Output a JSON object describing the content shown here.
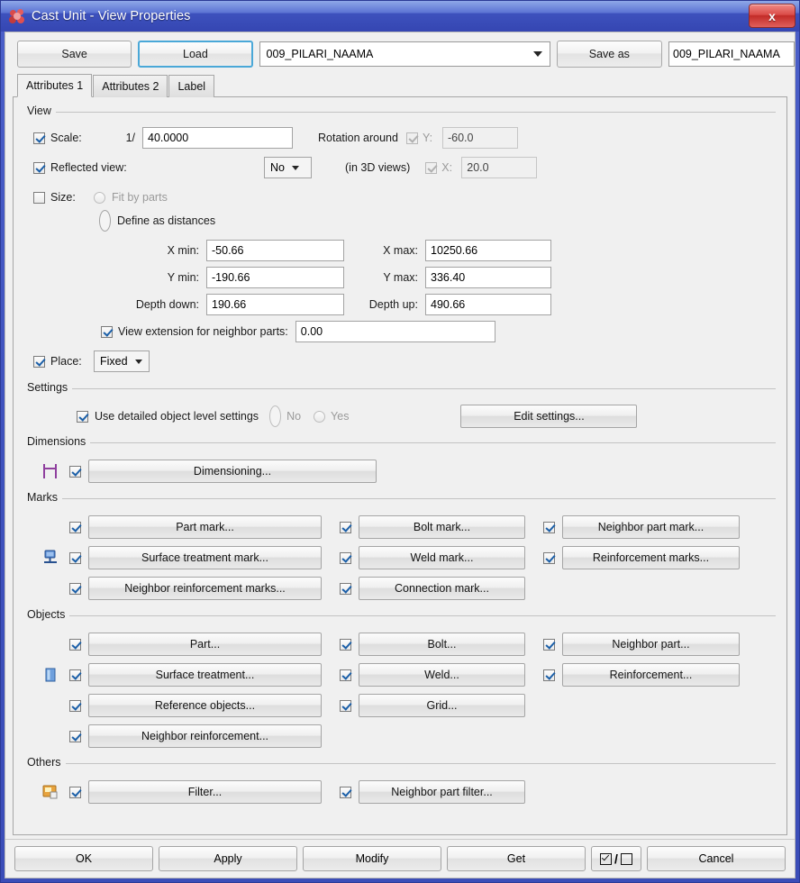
{
  "window": {
    "title": "Cast Unit - View Properties",
    "icon": "cast-unit-icon",
    "close_label": "x"
  },
  "preset_bar": {
    "save_label": "Save",
    "load_label": "Load",
    "preset_value": "009_PILARI_NAAMA",
    "save_as_label": "Save as",
    "save_as_value": "009_PILARI_NAAMA"
  },
  "tabs": [
    {
      "label": "Attributes 1",
      "active": true
    },
    {
      "label": "Attributes 2",
      "active": false
    },
    {
      "label": "Label",
      "active": false
    }
  ],
  "view_group": {
    "title": "View",
    "scale_label": "Scale:",
    "scale_prefix": "1/",
    "scale_value": "40.0000",
    "reflected_label": "Reflected view:",
    "reflected_value": "No",
    "rotation_label": "Rotation around",
    "rotation_sub_label": "(in 3D views)",
    "rot_y_label": "Y:",
    "rot_y_value": "-60.0",
    "rot_x_label": "X:",
    "rot_x_value": "20.0",
    "size_label": "Size:",
    "fit_by_parts_label": "Fit by parts",
    "define_as_distances_label": "Define as distances",
    "x_min_label": "X min:",
    "x_min_value": "-50.66",
    "x_max_label": "X max:",
    "x_max_value": "10250.66",
    "y_min_label": "Y min:",
    "y_min_value": "-190.66",
    "y_max_label": "Y max:",
    "y_max_value": "336.40",
    "depth_down_label": "Depth down:",
    "depth_down_value": "190.66",
    "depth_up_label": "Depth up:",
    "depth_up_value": "490.66",
    "view_extension_label": "View extension for neighbor parts:",
    "view_extension_value": "0.00",
    "place_label": "Place:",
    "place_value": "Fixed"
  },
  "settings_group": {
    "title": "Settings",
    "detailed_label": "Use detailed object level settings",
    "no_label": "No",
    "yes_label": "Yes",
    "edit_settings_label": "Edit settings..."
  },
  "dimensions_group": {
    "title": "Dimensions",
    "icon": "dimension-icon",
    "dimensioning_label": "Dimensioning..."
  },
  "marks_group": {
    "title": "Marks",
    "icon": "mark-tag-icon",
    "buttons": [
      {
        "label": "Part mark...",
        "checked": true
      },
      {
        "label": "Bolt mark...",
        "checked": true
      },
      {
        "label": "Neighbor part mark...",
        "checked": true
      },
      {
        "label": "Surface treatment mark...",
        "checked": true
      },
      {
        "label": "Weld mark...",
        "checked": true
      },
      {
        "label": "Reinforcement marks...",
        "checked": true
      },
      {
        "label": "Neighbor reinforcement marks...",
        "checked": true
      },
      {
        "label": "Connection mark...",
        "checked": true
      }
    ]
  },
  "objects_group": {
    "title": "Objects",
    "icon": "object-cube-icon",
    "buttons": [
      {
        "label": "Part...",
        "checked": true
      },
      {
        "label": "Bolt...",
        "checked": true
      },
      {
        "label": "Neighbor part...",
        "checked": true
      },
      {
        "label": "Surface treatment...",
        "checked": true
      },
      {
        "label": "Weld...",
        "checked": true
      },
      {
        "label": "Reinforcement...",
        "checked": true
      },
      {
        "label": "Reference objects...",
        "checked": true
      },
      {
        "label": "Grid...",
        "checked": true
      },
      {
        "label": "Neighbor reinforcement...",
        "checked": true
      }
    ]
  },
  "others_group": {
    "title": "Others",
    "icon": "filter-page-icon",
    "buttons": [
      {
        "label": "Filter...",
        "checked": true
      },
      {
        "label": "Neighbor part filter...",
        "checked": true
      }
    ]
  },
  "bottom_bar": {
    "ok_label": "OK",
    "apply_label": "Apply",
    "modify_label": "Modify",
    "get_label": "Get",
    "toggle_label": "/",
    "cancel_label": "Cancel"
  },
  "colors": {
    "title_bar": "#3d51bd",
    "focus_border": "#4aa8d8",
    "close_button": "#c22b27",
    "check_mark": "#1b5fa8"
  }
}
